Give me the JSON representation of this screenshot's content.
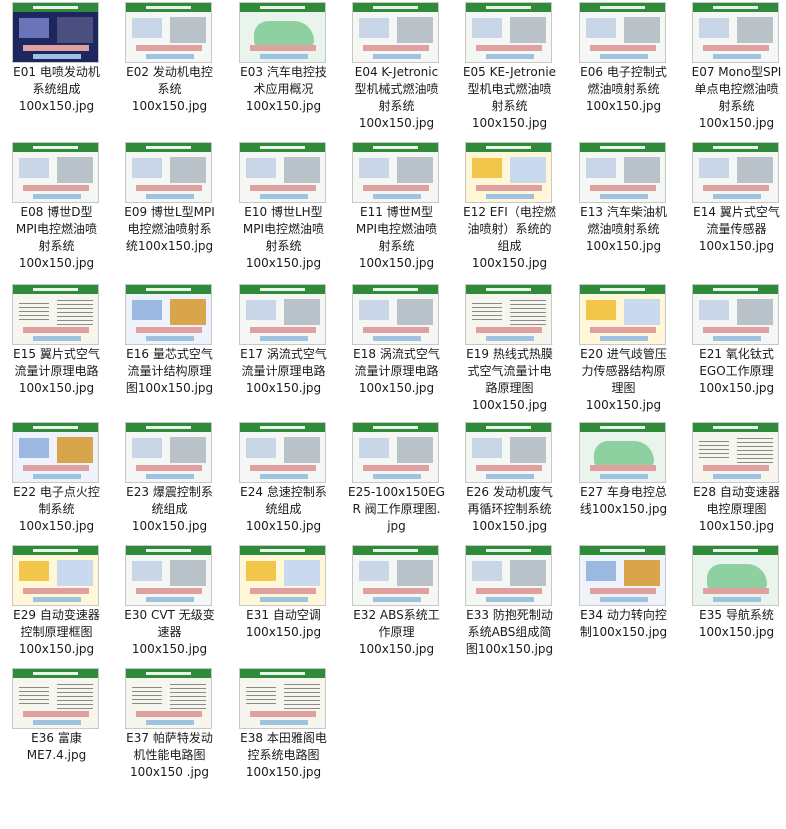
{
  "items": [
    {
      "name": "E01 电喷发动机系统组成100x150.jpg",
      "lines": [
        "E01 电喷发动机",
        "系统组成",
        "100x150.jpg"
      ],
      "style": "t-dark"
    },
    {
      "name": "E02 发动机电控系统100x150.jpg",
      "lines": [
        "E02 发动机电控",
        "系统",
        "100x150.jpg"
      ],
      "style": ""
    },
    {
      "name": "E03 汽车电控技术应用概况100x150.jpg",
      "lines": [
        "E03 汽车电控技",
        "术应用概况",
        "100x150.jpg"
      ],
      "style": "t-car"
    },
    {
      "name": "E04 K-Jetronic型机械式燃油喷射系统100x150.jpg",
      "lines": [
        "E04 K-Jetronic",
        "型机械式燃油喷",
        "射系统",
        "100x150.jpg"
      ],
      "style": ""
    },
    {
      "name": "E05 KE-Jetronie型机电式燃油喷射系统100x150.jpg",
      "lines": [
        "E05 KE-Jetronie",
        "型机电式燃油喷",
        "射系统",
        "100x150.jpg"
      ],
      "style": ""
    },
    {
      "name": "E06 电子控制式燃油喷射系统100x150.jpg",
      "lines": [
        "E06 电子控制式",
        "燃油喷射系统",
        "100x150.jpg"
      ],
      "style": ""
    },
    {
      "name": "E07 Mono型SPI单点电控燃油喷射系统100x150.jpg",
      "lines": [
        "E07 Mono型SPI",
        "单点电控燃油喷",
        "射系统",
        "100x150.jpg"
      ],
      "style": ""
    },
    {
      "name": "E08 博世D型MPI电控燃油喷射系统100x150.jpg",
      "lines": [
        "E08 博世D型",
        "MPI电控燃油喷",
        "射系统",
        "100x150.jpg"
      ],
      "style": ""
    },
    {
      "name": "E09 博世L型MPI电控燃油喷射系统100x150.jpg",
      "lines": [
        "E09 博世L型MPI",
        "电控燃油喷射系",
        "统100x150.jpg"
      ],
      "style": ""
    },
    {
      "name": "E10 博世LH型MPI电控燃油喷射系统100x150.jpg",
      "lines": [
        "E10 博世LH型",
        "MPI电控燃油喷",
        "射系统",
        "100x150.jpg"
      ],
      "style": ""
    },
    {
      "name": "E11 博世M型MPI电控燃油喷射系统100x150.jpg",
      "lines": [
        "E11 博世M型",
        "MPI电控燃油喷",
        "射系统",
        "100x150.jpg"
      ],
      "style": ""
    },
    {
      "name": "E12 EFI（电控燃油喷射）系统的组成100x150.jpg",
      "lines": [
        "E12 EFI（电控燃",
        "油喷射）系统的",
        "组成",
        "100x150.jpg"
      ],
      "style": "t-ylw"
    },
    {
      "name": "E13 汽车柴油机燃油喷射系统100x150.jpg",
      "lines": [
        "E13 汽车柴油机",
        "燃油喷射系统",
        "100x150.jpg"
      ],
      "style": ""
    },
    {
      "name": "E14 翼片式空气流量传感器100x150.jpg",
      "lines": [
        "E14 翼片式空气",
        "流量传感器",
        "100x150.jpg"
      ],
      "style": ""
    },
    {
      "name": "E15 翼片式空气流量计原理电路100x150.jpg",
      "lines": [
        "E15 翼片式空气",
        "流量计原理电路",
        "100x150.jpg"
      ],
      "style": "t-wire"
    },
    {
      "name": "E16 量芯式空气流量计结构原理图100x150.jpg",
      "lines": [
        "E16 量芯式空气",
        "流量计结构原理",
        "图100x150.jpg"
      ],
      "style": "t-blue"
    },
    {
      "name": "E17 涡流式空气流量计原理电路100x150.jpg",
      "lines": [
        "E17 涡流式空气",
        "流量计原理电路",
        "100x150.jpg"
      ],
      "style": ""
    },
    {
      "name": "E18 涡流式空气流量计原理电路100x150.jpg",
      "lines": [
        "E18 涡流式空气",
        "流量计原理电路",
        "100x150.jpg"
      ],
      "style": ""
    },
    {
      "name": "E19 热线式热膜式空气流量计电路原理图100x150.jpg",
      "lines": [
        "E19 热线式热膜",
        "式空气流量计电",
        "路原理图",
        "100x150.jpg"
      ],
      "style": "t-wire"
    },
    {
      "name": "E20 进气歧管压力传感器结构原理图100x150.jpg",
      "lines": [
        "E20 进气歧管压",
        "力传感器结构原",
        "理图",
        "100x150.jpg"
      ],
      "style": "t-ylw"
    },
    {
      "name": "E21 氧化钛式EGO工作原理100x150.jpg",
      "lines": [
        "E21 氧化钛式",
        "EGO工作原理",
        "100x150.jpg"
      ],
      "style": ""
    },
    {
      "name": "E22 电子点火控制系统100x150.jpg",
      "lines": [
        "E22 电子点火控",
        "制系统",
        "100x150.jpg"
      ],
      "style": "t-blue"
    },
    {
      "name": "E23 爆震控制系统组成100x150.jpg",
      "lines": [
        "E23 爆震控制系",
        "统组成",
        "100x150.jpg"
      ],
      "style": ""
    },
    {
      "name": "E24 怠速控制系统组成100x150.jpg",
      "lines": [
        "E24 怠速控制系",
        "统组成",
        "100x150.jpg"
      ],
      "style": ""
    },
    {
      "name": "E25-100x150EGR 阀工作原理图.jpg",
      "lines": [
        "E25-100x150EG",
        "R 阀工作原理图.",
        "jpg"
      ],
      "style": ""
    },
    {
      "name": "E26 发动机废气再循环控制系统100x150.jpg",
      "lines": [
        "E26 发动机废气",
        "再循环控制系统",
        "100x150.jpg"
      ],
      "style": ""
    },
    {
      "name": "E27 车身电控总线100x150.jpg",
      "lines": [
        "E27 车身电控总",
        "线100x150.jpg"
      ],
      "style": "t-car"
    },
    {
      "name": "E28 自动变速器电控原理图100x150.jpg",
      "lines": [
        "E28 自动变速器",
        "电控原理图",
        "100x150.jpg"
      ],
      "style": "t-wire"
    },
    {
      "name": "E29 自动变速器控制原理框图100x150.jpg",
      "lines": [
        "E29 自动变速器",
        "控制原理框图",
        "100x150.jpg"
      ],
      "style": "t-ylw"
    },
    {
      "name": "E30 CVT 无级变速器100x150.jpg",
      "lines": [
        "E30 CVT 无级变",
        "速器",
        "100x150.jpg"
      ],
      "style": ""
    },
    {
      "name": "E31 自动空调100x150.jpg",
      "lines": [
        "E31 自动空调",
        "100x150.jpg"
      ],
      "style": "t-ylw"
    },
    {
      "name": "E32 ABS系统工作原理100x150.jpg",
      "lines": [
        "E32 ABS系统工",
        "作原理",
        "100x150.jpg"
      ],
      "style": ""
    },
    {
      "name": "E33 防抱死制动系统ABS组成简图100x150.jpg",
      "lines": [
        "E33 防抱死制动",
        "系统ABS组成简",
        "图100x150.jpg"
      ],
      "style": ""
    },
    {
      "name": "E34 动力转向控制100x150.jpg",
      "lines": [
        "E34 动力转向控",
        "制100x150.jpg"
      ],
      "style": "t-blue"
    },
    {
      "name": "E35 导航系统100x150.jpg",
      "lines": [
        "E35 导航系统",
        "100x150.jpg"
      ],
      "style": "t-car"
    },
    {
      "name": "E36 富康ME7.4.jpg",
      "lines": [
        "E36 富康",
        "ME7.4.jpg"
      ],
      "style": "t-wire"
    },
    {
      "name": "E37 帕萨特发动机性能电路图100x150 .jpg",
      "lines": [
        "E37 帕萨特发动",
        "机性能电路图",
        "100x150 .jpg"
      ],
      "style": "t-wire"
    },
    {
      "name": "E38 本田雅阁电控系统电路图100x150.jpg",
      "lines": [
        "E38 本田雅阁电",
        "控系统电路图",
        "100x150.jpg"
      ],
      "style": "t-wire"
    }
  ]
}
